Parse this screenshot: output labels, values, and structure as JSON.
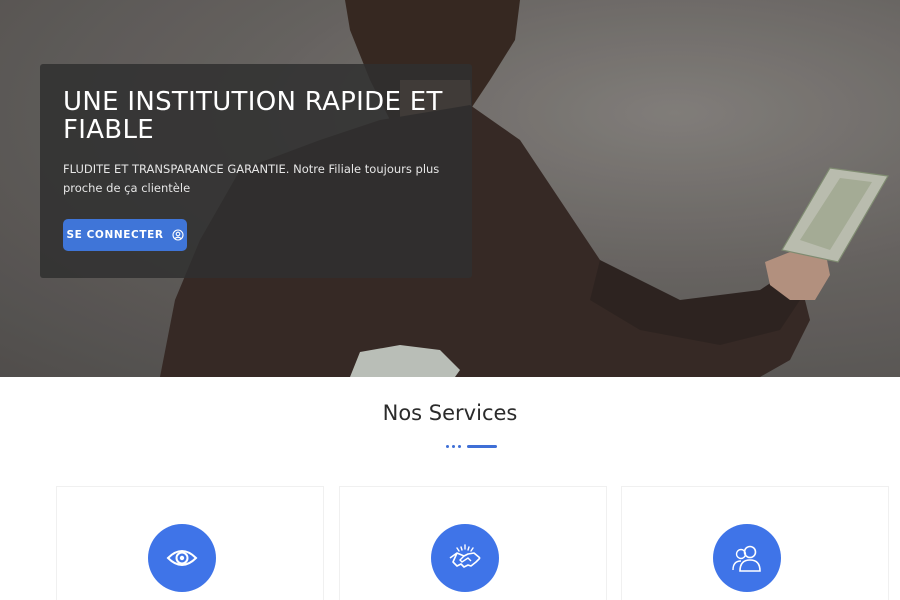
{
  "hero": {
    "title": "UNE INSTITUTION RAPIDE ET FIABLE",
    "subtitle": "FLUDITE ET TRANSPARANCE GARANTIE. Notre Filiale toujours plus proche de ça clientèle",
    "login_button": {
      "label": "SE CONNECTER",
      "icon": "user-circle-icon"
    },
    "card_color": "#303030",
    "button_color": "#3f75d8"
  },
  "services": {
    "title": "Nos Services",
    "accent_color": "#3f74e8",
    "items": [
      {
        "icon": "eye-icon"
      },
      {
        "icon": "handshake-icon"
      },
      {
        "icon": "users-icon"
      }
    ]
  }
}
